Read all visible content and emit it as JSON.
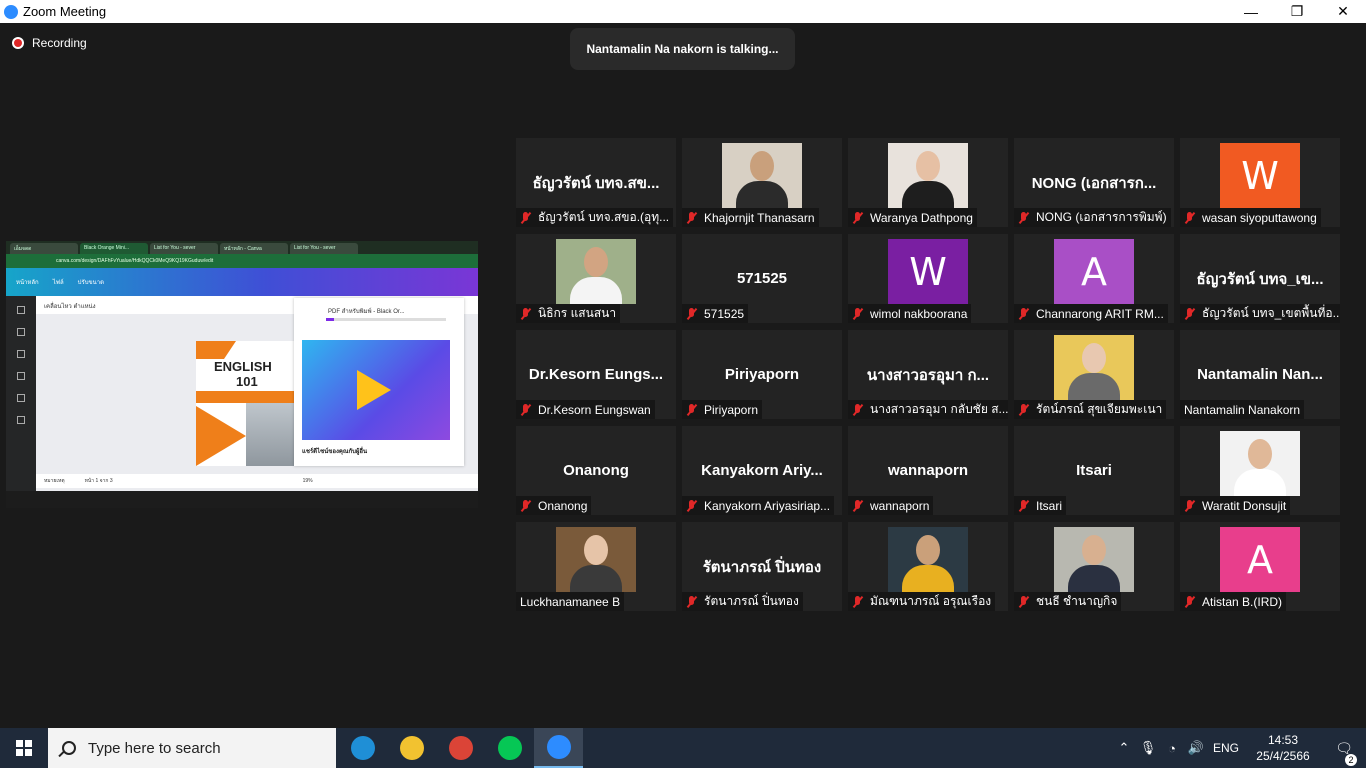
{
  "window": {
    "title": "Zoom Meeting",
    "minimize": "—",
    "maximize": "❐",
    "close": "✕"
  },
  "meeting": {
    "recording_label": "Recording",
    "talking_banner": "Nantamalin Na nakorn is talking..."
  },
  "shared_screen": {
    "tabs": [
      "เอ็มจดด",
      "Black Orange Mini...",
      "List for You - sever",
      "หน้าหลัก - Canva",
      "List for You - sever"
    ],
    "url": "canva.com/design/DAFhFvYualue/HdkQQCk0MeQ9KQ19KGuduw/edit",
    "canva_menu": [
      "หน้าหลัก",
      "ไฟล์",
      "ปรับขนาด"
    ],
    "toolbar_text": "เคลื่อนไหว    ตำแหน่ง",
    "page_title": "ENGLISH",
    "page_number": "101",
    "panel_title": "PDF สำหรับพิมพ์ - Black Or...",
    "panel_caption": "แชร์ดีไซน์ของคุณกับผู้อื่น",
    "footer_notes": "หมายเหตุ",
    "footer_page": "หน้า 1 จาก 3",
    "footer_zoom": "19%"
  },
  "participants": [
    {
      "name": "ธัญวรัตน์ บทจ.สขอ.(อุทุ...",
      "display": "ธัญวรัตน์ บทจ.สข...",
      "muted": true,
      "kind": "name"
    },
    {
      "name": "Khajornjit Thanasarn",
      "muted": true,
      "kind": "photo",
      "bg": "#d8d0c4",
      "skin": "#c9a07c",
      "cloth": "#2b2b2b"
    },
    {
      "name": "Waranya Dathpong",
      "muted": true,
      "kind": "photo",
      "bg": "#e8e2dc",
      "skin": "#e6c0a4",
      "cloth": "#1e1e1e"
    },
    {
      "name": "NONG (เอกสารการพิมพ์)",
      "display": "NONG (เอกสารก...",
      "muted": true,
      "kind": "name"
    },
    {
      "name": "wasan siyoputtawong",
      "muted": true,
      "kind": "avatar",
      "letter": "W",
      "color": "#f15a22"
    },
    {
      "name": "นิธิกร แสนสนา",
      "muted": true,
      "kind": "photo",
      "bg": "#9fb08a",
      "skin": "#d2a482",
      "cloth": "#f4f4f4"
    },
    {
      "name": "571525",
      "display": "571525",
      "muted": true,
      "kind": "name"
    },
    {
      "name": "wimol nakboorana",
      "muted": true,
      "kind": "avatar",
      "letter": "W",
      "color": "#7a1fa2"
    },
    {
      "name": "Channarong ARIT RM...",
      "muted": true,
      "kind": "avatar",
      "letter": "A",
      "color": "#a94fc6"
    },
    {
      "name": "ธัญวรัตน์ บทจ_เขตพื้นที่อ...",
      "display": "ธัญวรัตน์ บทจ_เข...",
      "muted": true,
      "kind": "name"
    },
    {
      "name": "Dr.Kesorn Eungswan",
      "display": "Dr.Kesorn Eungs...",
      "muted": true,
      "kind": "name"
    },
    {
      "name": "Piriyaporn",
      "display": "Piriyaporn",
      "muted": true,
      "kind": "name"
    },
    {
      "name": "นางสาวอรอุมา กลับชัย ส...",
      "display": "นางสาวอรอุมา ก...",
      "muted": true,
      "kind": "name"
    },
    {
      "name": "รัตน์ภรณ์ สุขเจียมพะเนา",
      "muted": true,
      "kind": "photo",
      "bg": "#e9c85a",
      "skin": "#e8c8b0",
      "cloth": "#6a6a6a"
    },
    {
      "name": "Nantamalin Nanakorn",
      "display": "Nantamalin Nan...",
      "muted": false,
      "kind": "name"
    },
    {
      "name": "Onanong",
      "display": "Onanong",
      "muted": true,
      "kind": "name"
    },
    {
      "name": "Kanyakorn Ariyasiriap...",
      "display": "Kanyakorn Ariy...",
      "muted": true,
      "kind": "name"
    },
    {
      "name": "wannaporn",
      "display": "wannaporn",
      "muted": true,
      "kind": "name"
    },
    {
      "name": "Itsari",
      "display": "Itsari",
      "muted": true,
      "kind": "name"
    },
    {
      "name": "Waratit Donsujit",
      "muted": true,
      "kind": "photo",
      "bg": "#f2f2f2",
      "skin": "#e0b898",
      "cloth": "#ffffff"
    },
    {
      "name": "Luckhanamanee B",
      "muted": false,
      "kind": "photo",
      "bg": "#7a5a3a",
      "skin": "#e6c4a8",
      "cloth": "#3a3a3a"
    },
    {
      "name": "รัตนาภรณ์ ปิ่นทอง",
      "display": "รัตนาภรณ์ ปิ่นทอง",
      "muted": true,
      "kind": "name"
    },
    {
      "name": "มัณฑนาภรณ์ อรุณเรือง",
      "muted": true,
      "kind": "photo",
      "bg": "#2c3a44",
      "skin": "#caa07a",
      "cloth": "#e8b020"
    },
    {
      "name": "ชนธี ชำนาญกิจ",
      "muted": true,
      "kind": "photo",
      "bg": "#b8b8b0",
      "skin": "#d8b090",
      "cloth": "#2a3040"
    },
    {
      "name": "Atistan B.(IRD)",
      "muted": true,
      "kind": "avatar",
      "letter": "A",
      "color": "#e83e8c"
    }
  ],
  "taskbar": {
    "search_placeholder": "Type here to search",
    "apps": [
      {
        "name": "edge-icon",
        "color": "#1f8fd6"
      },
      {
        "name": "file-explorer-icon",
        "color": "#f2c230"
      },
      {
        "name": "chrome-icon",
        "color": "#db4437"
      },
      {
        "name": "line-icon",
        "color": "#06c755"
      },
      {
        "name": "zoom-icon",
        "color": "#2d8cff"
      }
    ],
    "language": "ENG",
    "time": "14:53",
    "date": "25/4/2566",
    "notification_count": "2"
  }
}
